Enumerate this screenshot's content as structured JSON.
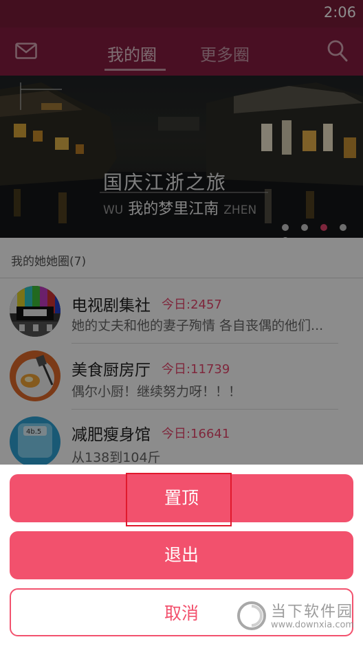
{
  "status_bar": {
    "time": "2:06"
  },
  "header": {
    "tabs": [
      {
        "label": "我的圈",
        "active": true
      },
      {
        "label": "更多圈",
        "active": false
      }
    ],
    "icons": {
      "left": "mail-icon",
      "right": "search-icon"
    }
  },
  "banner": {
    "line1": "国庆江浙之旅",
    "line2": "我的梦里江南",
    "ghost_left": "WU",
    "ghost_right": "ZHEN",
    "page_count": 5,
    "active_page_index": 2
  },
  "section": {
    "title": "我的她她圈(7)"
  },
  "circles": [
    {
      "name": "电视剧集社",
      "today": "今日:2457",
      "desc": "她的丈夫和他的妻子殉情 各自丧偶的他们...",
      "avatar": "tv-test-pattern"
    },
    {
      "name": "美食厨房厅",
      "today": "今日:11739",
      "desc": "偶尔小厨！继续努力呀！！！",
      "avatar": "food-plate"
    },
    {
      "name": "减肥瘦身馆",
      "today": "今日:16641",
      "desc": "从138到104斤",
      "avatar": "scale"
    }
  ],
  "sheet": {
    "pin": "置顶",
    "quit": "退出",
    "cancel": "取消"
  },
  "watermark": {
    "name": "当下软件园",
    "url": "www.downxia.com"
  },
  "colors": {
    "header": "#851d40",
    "accent": "#f2516d",
    "today": "#e8486e"
  }
}
